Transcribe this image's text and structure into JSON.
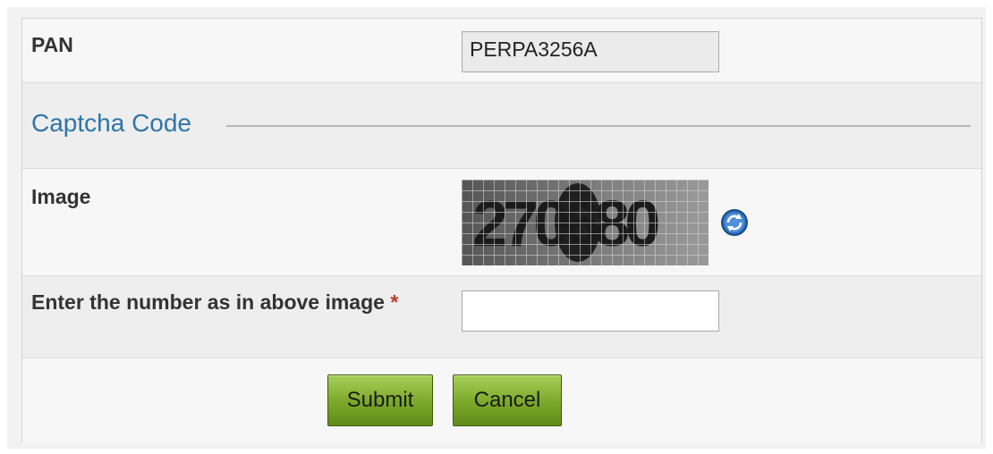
{
  "form": {
    "pan_label": "PAN",
    "pan_value": "PERPA3256A",
    "captcha_section_title": "Captcha Code",
    "image_label": "Image",
    "captcha_text": "270680",
    "enter_number_label": "Enter the number as in above image",
    "required_marker": "*",
    "number_input_value": "",
    "submit_label": "Submit",
    "cancel_label": "Cancel"
  },
  "icons": {
    "refresh": "refresh-icon"
  },
  "colors": {
    "section_title": "#2e75a8",
    "button_green": "#7aa82a",
    "required_star": "#c0392b"
  }
}
